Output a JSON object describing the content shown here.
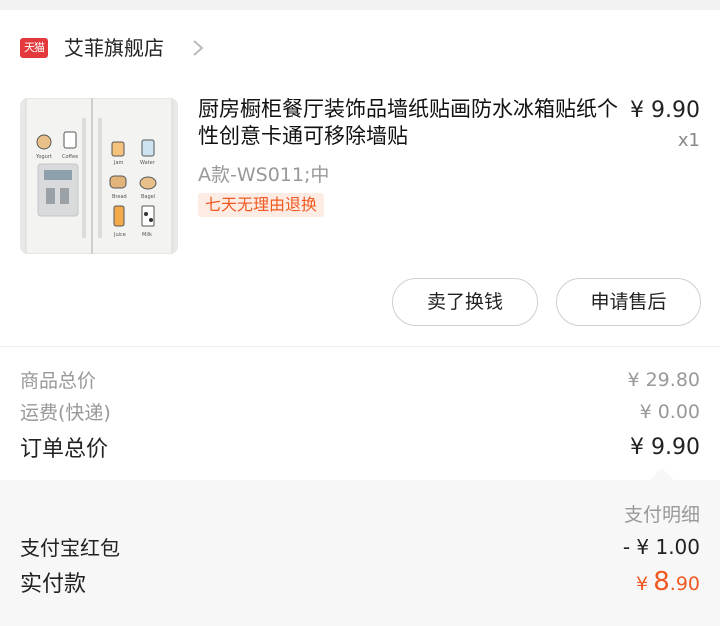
{
  "shop": {
    "platform_badge": "天猫",
    "name": "艾菲旗舰店"
  },
  "product": {
    "title": "厨房橱柜餐厅装饰品墙纸贴画防水冰箱贴纸个性创意卡通可移除墙贴",
    "price": "¥ 9.90",
    "quantity": "x1",
    "spec": "A款-WS011;中",
    "service_tag": "七天无理由退换",
    "image_labels": [
      "Yogurt",
      "Coffee",
      "Jam",
      "Water",
      "Bread",
      "Bagel",
      "Juice",
      "Milk"
    ]
  },
  "actions": {
    "sell_label": "卖了换钱",
    "after_sale_label": "申请售后"
  },
  "totals": {
    "goods_total_label": "商品总价",
    "goods_total_value": "¥ 29.80",
    "shipping_label": "运费(快递)",
    "shipping_value": "¥ 0.00",
    "order_total_label": "订单总价",
    "order_total_value": "¥ 9.90"
  },
  "payment": {
    "detail_header": "支付明细",
    "red_packet_label": "支付宝红包",
    "red_packet_value": "- ¥ 1.00",
    "paid_label": "实付款",
    "paid_currency": "¥",
    "paid_integer": "8",
    "paid_decimal": ".90"
  },
  "colors": {
    "accent": "#f05a22",
    "tmall_red": "#e4393c",
    "muted_text": "#999999"
  }
}
